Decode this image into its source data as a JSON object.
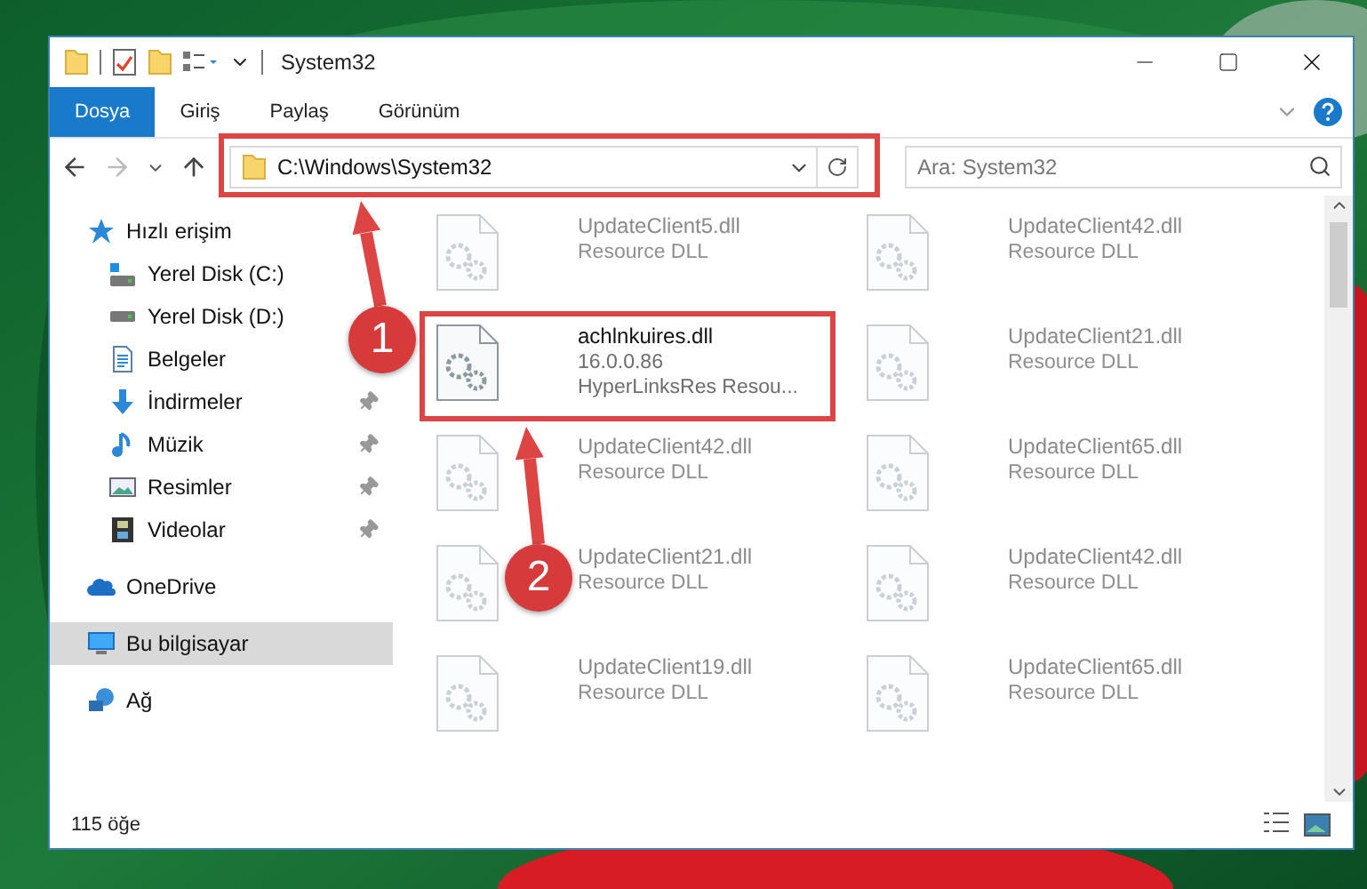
{
  "window": {
    "title": "System32"
  },
  "ribbon_tabs": [
    {
      "label": "Dosya",
      "selected": true
    },
    {
      "label": "Giriş",
      "selected": false
    },
    {
      "label": "Paylaş",
      "selected": false
    },
    {
      "label": "Görünüm",
      "selected": false
    }
  ],
  "address_bar": {
    "path": "C:\\Windows\\System32"
  },
  "search": {
    "placeholder": "Ara: System32"
  },
  "sidebar": {
    "items": [
      {
        "label": "Hızlı erişim",
        "kind": "star",
        "selected": false,
        "children": [
          {
            "label": "Yerel Disk (C:)",
            "kind": "system-drive",
            "selected": false,
            "pinned": false
          },
          {
            "label": "Yerel Disk (D:)",
            "kind": "drive",
            "selected": false,
            "pinned": false
          },
          {
            "label": "Belgeler",
            "kind": "documents",
            "selected": false,
            "pinned": false
          },
          {
            "label": "İndirmeler",
            "kind": "download",
            "selected": false,
            "pinned": true
          },
          {
            "label": "Müzik",
            "kind": "music",
            "selected": false,
            "pinned": true
          },
          {
            "label": "Resimler",
            "kind": "pictures",
            "selected": false,
            "pinned": true
          },
          {
            "label": "Videolar",
            "kind": "videos",
            "selected": false,
            "pinned": true
          }
        ]
      },
      {
        "label": "OneDrive",
        "kind": "cloud",
        "selected": false
      },
      {
        "label": "Bu bilgisayar",
        "kind": "computer",
        "selected": true
      },
      {
        "label": "Ağ",
        "kind": "network",
        "selected": false
      }
    ]
  },
  "files": [
    {
      "name": "UpdateClient5.dll",
      "details": [
        "Resource DLL"
      ],
      "faded": true
    },
    {
      "name": "UpdateClient42.dll",
      "details": [
        "Resource DLL"
      ],
      "faded": true
    },
    {
      "name": "achlnkuires.dll",
      "details": [
        "16.0.0.86",
        "HyperLinksRes Resou..."
      ],
      "faded": false
    },
    {
      "name": "UpdateClient21.dll",
      "details": [
        "Resource DLL"
      ],
      "faded": true
    },
    {
      "name": "UpdateClient42.dll",
      "details": [
        "Resource DLL"
      ],
      "faded": true
    },
    {
      "name": "UpdateClient65.dll",
      "details": [
        "Resource DLL"
      ],
      "faded": true
    },
    {
      "name": "UpdateClient21.dll",
      "details": [
        "Resource DLL"
      ],
      "faded": true
    },
    {
      "name": "UpdateClient42.dll",
      "details": [
        "Resource DLL"
      ],
      "faded": true
    },
    {
      "name": "UpdateClient19.dll",
      "details": [
        "Resource DLL"
      ],
      "faded": true
    },
    {
      "name": "UpdateClient65.dll",
      "details": [
        "Resource DLL"
      ],
      "faded": true
    }
  ],
  "status_bar": {
    "item_count": "115 öğe"
  },
  "callouts": [
    {
      "number": "1"
    },
    {
      "number": "2"
    }
  ]
}
